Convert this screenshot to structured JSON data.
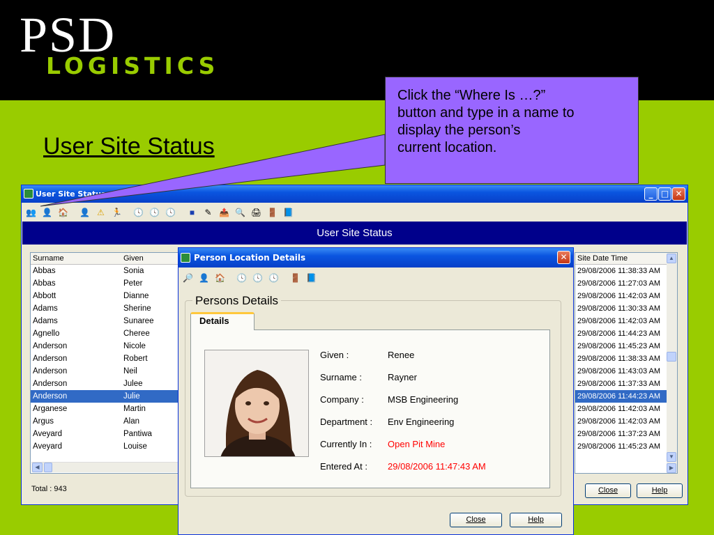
{
  "slide": {
    "logo_top": "PSD",
    "logo_bottom": "LOGISTICS",
    "title": "User Site Status",
    "callout_lines": [
      "Click the “Where Is …?”",
      "button and type in a name to",
      "display the person’s",
      "current location."
    ]
  },
  "main_window": {
    "title": "User Site Status",
    "banner": "User Site Status",
    "columns": {
      "surname": "Surname",
      "given": "Given",
      "site_date_time": "Site Date Time"
    },
    "rows": [
      {
        "surname": "Abbas",
        "given": "Sonia",
        "time": "29/08/2006 11:38:33 AM"
      },
      {
        "surname": "Abbas",
        "given": "Peter",
        "time": "29/08/2006 11:27:03 AM"
      },
      {
        "surname": "Abbott",
        "given": "Dianne",
        "time": "29/08/2006 11:42:03 AM"
      },
      {
        "surname": "Adams",
        "given": "Sherine",
        "time": "29/08/2006 11:30:33 AM"
      },
      {
        "surname": "Adams",
        "given": "Sunaree",
        "time": "29/08/2006 11:42:03 AM"
      },
      {
        "surname": "Agnello",
        "given": "Cheree",
        "time": "29/08/2006 11:44:23 AM"
      },
      {
        "surname": "Anderson",
        "given": "Nicole",
        "time": "29/08/2006 11:45:23 AM"
      },
      {
        "surname": "Anderson",
        "given": "Robert",
        "time": "29/08/2006 11:38:33 AM"
      },
      {
        "surname": "Anderson",
        "given": "Neil",
        "time": "29/08/2006 11:43:03 AM"
      },
      {
        "surname": "Anderson",
        "given": "Julee",
        "time": "29/08/2006 11:37:33 AM"
      },
      {
        "surname": "Anderson",
        "given": "Julie",
        "time": "29/08/2006 11:44:23 AM"
      },
      {
        "surname": "Arganese",
        "given": "Martin",
        "time": "29/08/2006 11:42:03 AM"
      },
      {
        "surname": "Argus",
        "given": "Alan",
        "time": "29/08/2006 11:42:03 AM"
      },
      {
        "surname": "Aveyard",
        "given": "Pantiwa",
        "time": "29/08/2006 11:37:23 AM"
      },
      {
        "surname": "Aveyard",
        "given": "Louise",
        "time": "29/08/2006 11:45:23 AM"
      }
    ],
    "total": "Total : 943",
    "close_label": "Close",
    "help_label": "Help"
  },
  "dialog": {
    "title": "Person Location Details",
    "group_title": "Persons Details",
    "tab_label": "Details",
    "fields": [
      {
        "label": "Given :",
        "value": "Renee"
      },
      {
        "label": "Surname :",
        "value": "Rayner"
      },
      {
        "label": "Company :",
        "value": "MSB Engineering"
      },
      {
        "label": "Department :",
        "value": "Env Engineering"
      },
      {
        "label": "Currently In :",
        "value": "Open Pit Mine"
      },
      {
        "label": "Entered At :",
        "value": "29/08/2006 11:47:43 AM"
      }
    ],
    "close_label": "Close",
    "help_label": "Help"
  },
  "colors": {
    "slide_background": "#99cc00",
    "callout": "#9966ff",
    "banner": "#00008b",
    "selected_row": "#316ac5",
    "alert_text": "#ff0000"
  }
}
